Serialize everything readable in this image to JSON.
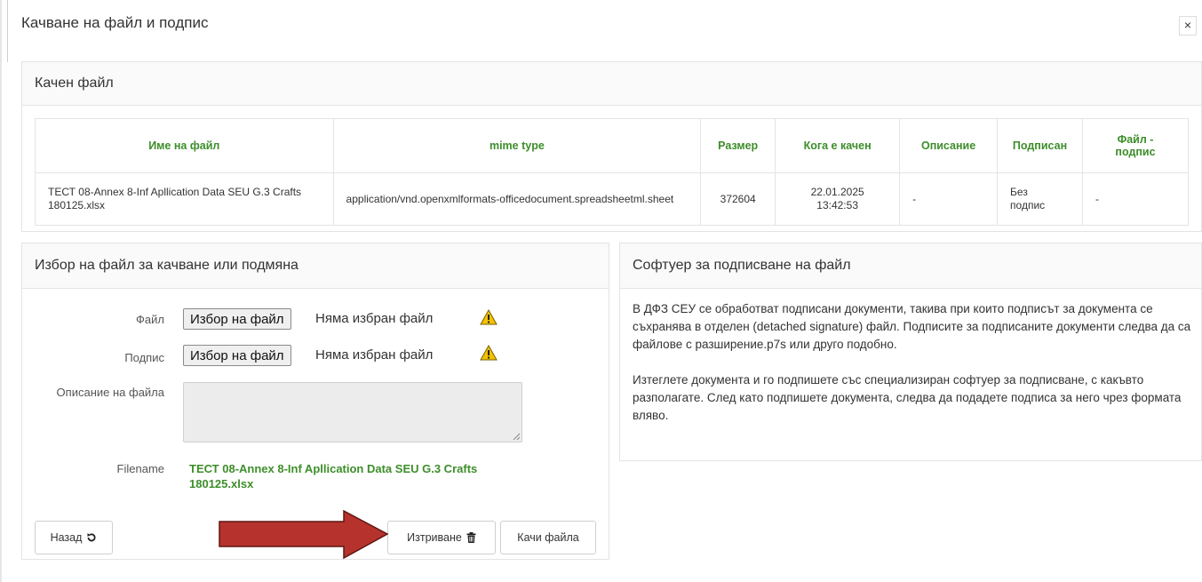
{
  "modal": {
    "title": "Качване на файл и подпис",
    "close_label": "×"
  },
  "uploaded_panel": {
    "title": "Качен файл",
    "columns": [
      "Име на файл",
      "mime type",
      "Размер",
      "Кога е качен",
      "Описание",
      "Подписан",
      "Файл - подпис"
    ],
    "rows": [
      {
        "name": "ТЕСТ 08-Annex 8-Inf Apllication Data SEU G.3 Crafts 180125.xlsx",
        "mime": "application/vnd.openxmlformats-officedocument.spreadsheetml.sheet",
        "size": "372604",
        "uploaded_at": "22.01.2025 13:42:53",
        "description": "-",
        "signed": "Без подпис",
        "signature_file": "-"
      }
    ]
  },
  "picker_panel": {
    "title": "Избор на файл за качване или подмяна",
    "file_label": "Файл",
    "signature_label": "Подпис",
    "choose_button": "Избор на файл",
    "no_file_text": "Няма избран файл",
    "description_label": "Описание на файла",
    "description_value": "",
    "filename_label": "Filename",
    "filename_value": "ТЕСТ 08-Annex 8-Inf Apllication Data SEU G.3 Crafts 180125.xlsx",
    "back_button": "Назад",
    "delete_button": "Изтриване",
    "upload_button": "Качи файла"
  },
  "software_panel": {
    "title": "Софтуер за подписване на файл",
    "paragraph1": "В ДФЗ СЕУ се обработват подписани документи, такива при които подписът за документа се съхранява в отделен (detached signature) файл. Подписите за подписаните документи следва да са файлове с разширение.p7s или друго подобно.",
    "paragraph2": "Изтеглете документа и го подпишете със специализиран софтуер за подписване, с какъвто разполагате. След като подпишете документа, следва да подадете подписа за него чрез формата вляво."
  },
  "colors": {
    "accent_green": "#3d8e2a",
    "arrow_red": "#b5332c",
    "warning_yellow": "#f2c200"
  },
  "icons": {
    "close": "close-icon",
    "warning": "warning-icon",
    "back": "refresh-icon",
    "delete": "trash-icon",
    "annotation": "red-arrow-icon"
  }
}
